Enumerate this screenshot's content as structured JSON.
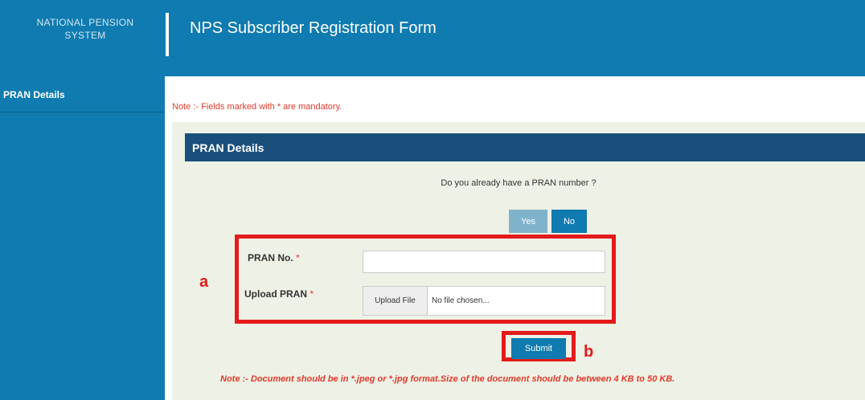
{
  "header": {
    "logo_line1": "NATIONAL PENSION",
    "logo_line2": "SYSTEM",
    "title": "NPS Subscriber Registration Form"
  },
  "sidebar": {
    "items": [
      {
        "label": "PRAN Details"
      }
    ]
  },
  "main": {
    "mandatory_note": "Note :- Fields marked with * are mandatory.",
    "panel": {
      "heading": "PRAN Details",
      "question": "Do you already have a PRAN number ?",
      "yes_label": "Yes",
      "no_label": "No",
      "fields": {
        "pran_no_label": "PRAN No.",
        "pran_no_value": "",
        "upload_label": "Upload PRAN",
        "required_mark": "*",
        "upload_button_label": "Upload File",
        "upload_status": "No file chosen..."
      },
      "submit_label": "Submit",
      "document_note": "Note :- Document should be in *.jpeg or *.jpg format.Size of the document should be between 4 KB to 50 KB."
    }
  },
  "annotations": {
    "label_a": "a",
    "label_b": "b"
  },
  "colors": {
    "header_blue": "#0f7bb0",
    "panel_heading": "#1a4f7c",
    "panel_background": "#eef1e6",
    "mandatory_red": "#e03a2b",
    "annotation_red": "#e31b1b",
    "yes_button": "#7fb3cc"
  }
}
